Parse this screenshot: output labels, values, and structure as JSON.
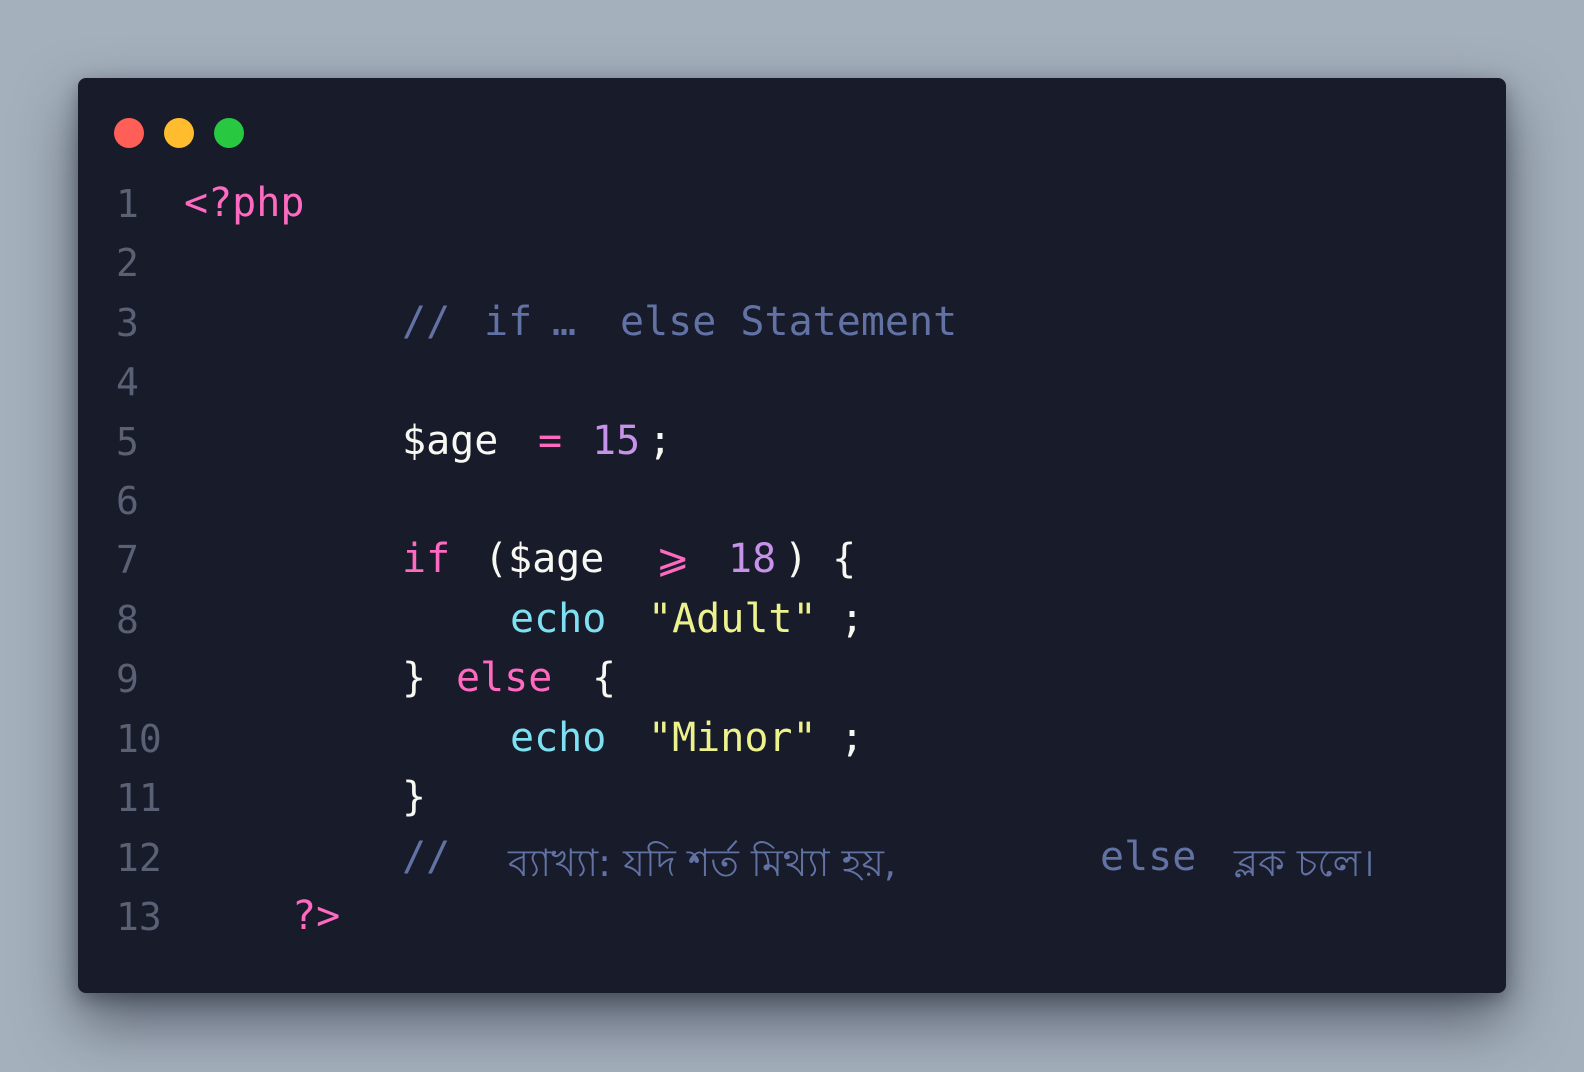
{
  "window": {
    "controls": {
      "close_color": "#ff5f57",
      "minimize_color": "#febc2e",
      "maximize_color": "#28c840"
    }
  },
  "editor": {
    "language": "php",
    "lines": [
      {
        "number": "1",
        "text": "<?php"
      },
      {
        "number": "2",
        "text": ""
      },
      {
        "number": "3",
        "text": "// if … else Statement"
      },
      {
        "number": "4",
        "text": ""
      },
      {
        "number": "5",
        "text": "$age = 15;"
      },
      {
        "number": "6",
        "text": ""
      },
      {
        "number": "7",
        "text": "if ($age ⩾ 18) {"
      },
      {
        "number": "8",
        "text": "echo \"Adult\";"
      },
      {
        "number": "9",
        "text": "} else {"
      },
      {
        "number": "10",
        "text": "echo \"Minor\";"
      },
      {
        "number": "11",
        "text": "}"
      },
      {
        "number": "12",
        "text": "//  ব্যাখ্যা: যদি শর্ত মিথ্যা হয়, else ব্লক চলে।"
      },
      {
        "number": "13",
        "text": "?>"
      }
    ],
    "tokens": {
      "open_tag": "<?php",
      "comment_1_slashes": "//",
      "comment_1_if": "if",
      "comment_1_ellipsis": "…",
      "comment_1_rest": "else Statement",
      "var_age": "$age",
      "assign_op": "=",
      "num_15": "15",
      "semicolon": ";",
      "kw_if": "if",
      "paren_open": "(",
      "var_age_2": "$age",
      "gte_op": "⩾",
      "num_18": "18",
      "paren_close_brace": ") {",
      "echo_1": "echo",
      "str_adult": "\"Adult\"",
      "semicolon_2": ";",
      "brace_close_1": "}",
      "kw_else": "else",
      "brace_open_2": "{",
      "echo_2": "echo",
      "str_minor": "\"Minor\"",
      "semicolon_3": ";",
      "brace_close_2": "}",
      "comment_2_slashes": "//",
      "comment_2_bn_1": "ব্যাখ্যা: যদি শর্ত মিথ্যা হয়,",
      "comment_2_else": "else",
      "comment_2_bn_2": "ব্লক চলে।",
      "close_tag": "?>"
    }
  }
}
